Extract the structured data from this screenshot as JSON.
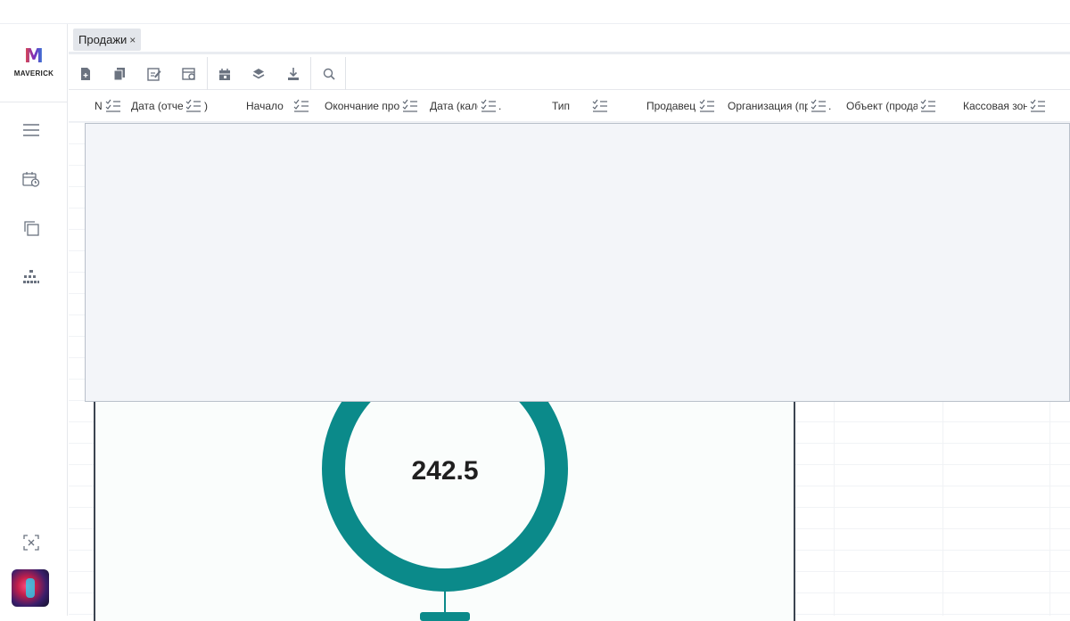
{
  "app": {
    "logo_text": "MAVERICK",
    "logo_mark": "M",
    "brand_colors": [
      "#e94b3c",
      "#7d2bbd",
      "#2f7fd8"
    ]
  },
  "sidebar": {
    "items": [
      {
        "icon": "menu-icon"
      },
      {
        "icon": "calendar-clock-icon"
      },
      {
        "icon": "copy-windows-icon"
      },
      {
        "icon": "hierarchy-icon"
      }
    ],
    "bottom": [
      {
        "icon": "exit-fullscreen-icon"
      },
      {
        "icon": "user-avatar"
      }
    ]
  },
  "tabs": [
    {
      "label": "Продажи",
      "close": "×",
      "active": true
    }
  ],
  "toolbar": {
    "buttons": [
      {
        "icon": "new-document-icon"
      },
      {
        "icon": "copy-document-icon"
      },
      {
        "icon": "edit-document-icon"
      },
      {
        "icon": "document-settings-icon"
      },
      {
        "icon": "calendar-icon"
      },
      {
        "icon": "layers-icon"
      },
      {
        "icon": "download-icon"
      },
      {
        "icon": "search-icon"
      }
    ]
  },
  "table": {
    "columns": [
      {
        "label": "N"
      },
      {
        "label": "Дата (отче",
        "suffix": ")"
      },
      {
        "label": "Начало"
      },
      {
        "label": "Окончание прод"
      },
      {
        "label": "Дата (кале",
        "suffix": "."
      },
      {
        "label": "Тип"
      },
      {
        "label": "Продавец"
      },
      {
        "label": "Организация (пр",
        "suffix": "."
      },
      {
        "label": "Объект (прода"
      },
      {
        "label": "Кассовая зон"
      }
    ]
  },
  "gauge": {
    "value_text": "242.5",
    "color": "#0b8a8a"
  }
}
